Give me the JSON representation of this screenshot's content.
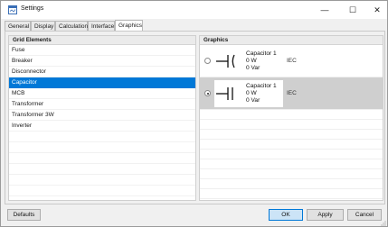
{
  "window": {
    "title": "Settings",
    "controls": {
      "minimize": "—",
      "maximize": "☐",
      "close": "✕"
    }
  },
  "tabs": [
    {
      "label": "General",
      "active": false
    },
    {
      "label": "Display",
      "active": false
    },
    {
      "label": "Calculation",
      "active": false
    },
    {
      "label": "Interface",
      "active": false
    },
    {
      "label": "Graphics",
      "active": true
    }
  ],
  "grid_elements": {
    "header": "Grid Elements",
    "items": [
      {
        "label": "Fuse",
        "selected": false
      },
      {
        "label": "Breaker",
        "selected": false
      },
      {
        "label": "Disconnector",
        "selected": false
      },
      {
        "label": "Capacitor",
        "selected": true
      },
      {
        "label": "MCB",
        "selected": false
      },
      {
        "label": "Transformer",
        "selected": false
      },
      {
        "label": "Transformer 3W",
        "selected": false
      },
      {
        "label": "Inverter",
        "selected": false
      }
    ]
  },
  "graphics": {
    "header": "Graphics",
    "options": [
      {
        "name": "Capacitor 1",
        "power": "0 W",
        "reactive": "0 Var",
        "standard": "IEC",
        "selected": false,
        "symbol": "capacitor-curved-plate-icon"
      },
      {
        "name": "Capacitor 1",
        "power": "0 W",
        "reactive": "0 Var",
        "standard": "IEC",
        "selected": true,
        "symbol": "capacitor-parallel-plate-icon"
      }
    ]
  },
  "buttons": {
    "defaults": "Defaults",
    "ok": "OK",
    "apply": "Apply",
    "cancel": "Cancel"
  },
  "colors": {
    "selection": "#0078d7",
    "primary_button": "#cce4f7"
  }
}
